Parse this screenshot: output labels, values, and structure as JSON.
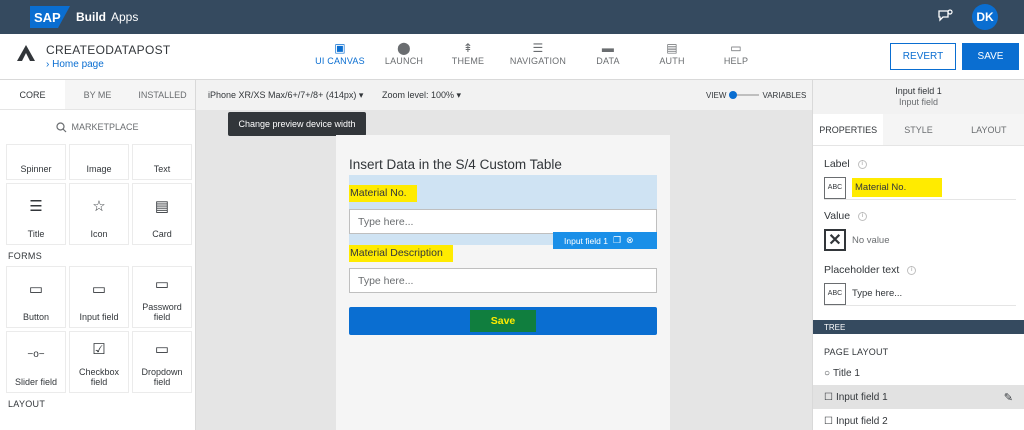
{
  "shell": {
    "logo": "SAP",
    "title": "Build",
    "subtitle": "Apps",
    "chat_icon": "chat-icon",
    "avatar_initials": "DK"
  },
  "header": {
    "app_name": "CREATEODATAPOST",
    "breadcrumb": "Home page",
    "nav": [
      {
        "label": "UI CANVAS",
        "icon": "▣"
      },
      {
        "label": "LAUNCH",
        "icon": "⬤"
      },
      {
        "label": "THEME",
        "icon": "⇞"
      },
      {
        "label": "NAVIGATION",
        "icon": "☰"
      },
      {
        "label": "DATA",
        "icon": "▬"
      },
      {
        "label": "AUTH",
        "icon": "▤"
      },
      {
        "label": "HELP",
        "icon": "▭"
      }
    ],
    "revert_label": "REVERT",
    "save_label": "SAVE"
  },
  "left": {
    "tabs": [
      "CORE",
      "BY ME",
      "INSTALLED"
    ],
    "marketplace": "MARKETPLACE",
    "top_tiles": [
      "Spinner",
      "Image",
      "Text"
    ],
    "tiles_1": [
      {
        "label": "Title",
        "icon": "☰"
      },
      {
        "label": "Icon",
        "icon": "☆"
      },
      {
        "label": "Card",
        "icon": "▤"
      }
    ],
    "forms_label": "FORMS",
    "tiles_2": [
      {
        "label": "Button",
        "icon": "▭"
      },
      {
        "label": "Input field",
        "icon": "▭"
      },
      {
        "label": "Password field",
        "icon": "▭"
      }
    ],
    "tiles_3": [
      {
        "label": "Slider field",
        "icon": "−o−"
      },
      {
        "label": "Checkbox field",
        "icon": "☑"
      },
      {
        "label": "Dropdown field",
        "icon": "▭"
      }
    ],
    "layout_label": "LAYOUT"
  },
  "canvas": {
    "device": "iPhone XR/XS Max/6+/7+/8+ (414px) ▾",
    "zoom": "Zoom level: 100% ▾",
    "view_label": "VIEW",
    "variables_label": "VARIABLES",
    "tooltip": "Change preview device width",
    "title": "Insert Data in the S/4 Custom Table",
    "field1_label": "Material No.",
    "field1_placeholder": "Type here...",
    "field2_label": "Material Description",
    "field2_placeholder": "Type here...",
    "chip_label": "Input field 1",
    "save_button": "Save"
  },
  "right": {
    "selected_title": "Input field 1",
    "selected_subtitle": "Input field",
    "tabs": [
      "PROPERTIES",
      "STYLE",
      "LAYOUT"
    ],
    "label_title": "Label",
    "label_value": "Material No.",
    "value_title": "Value",
    "value_value": "No value",
    "placeholder_title": "Placeholder text",
    "placeholder_value": "Type here...",
    "abc_glyph": "ABC",
    "tree_label": "TREE",
    "page_layout": "PAGE LAYOUT",
    "tree_items": [
      "Title 1",
      "Input field 1",
      "Input field 2"
    ]
  },
  "colors": {
    "shell": "#354a5f",
    "accent": "#0a6ed1",
    "highlight": "#ffeb00",
    "save_green": "#107e3e"
  }
}
